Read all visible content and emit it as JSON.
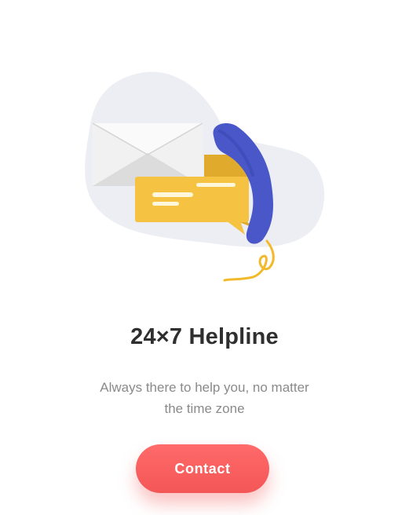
{
  "onboarding": {
    "title": "24×7 Helpline",
    "description_line1": "Always there to help you, no matter",
    "description_line2": "the time zone",
    "cta_label": "Contact"
  },
  "illustration": {
    "icons": [
      "envelope-icon",
      "chat-bubble-icon",
      "telephone-handset-icon"
    ],
    "colors": {
      "blob": "#eceef3",
      "envelope": "#f1f1f1",
      "chat_bubble": "#f5c242",
      "handset": "#4a57c9",
      "cord": "#f2b92b"
    }
  },
  "theme": {
    "accent": "#f45656",
    "title_color": "#2f2f2f",
    "text_color": "#8a8a8a"
  }
}
